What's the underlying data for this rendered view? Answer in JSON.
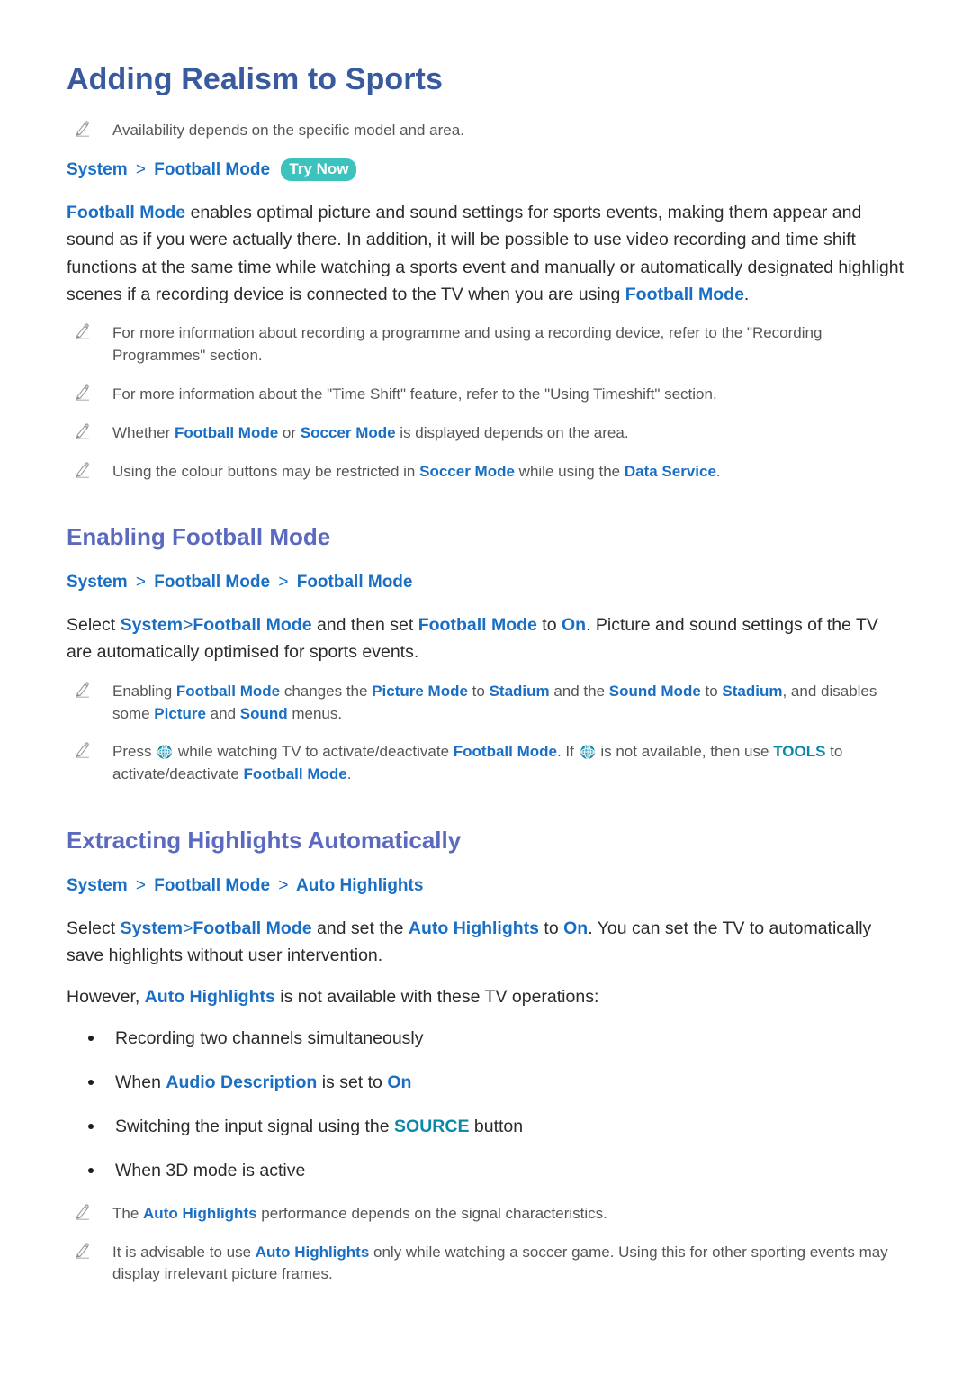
{
  "colors": {
    "title": "#3a5a9e",
    "section_heading": "#5b6abf",
    "link_blue": "#1a6fc4",
    "teal_accent": "#0d87a8",
    "badge_teal": "#3cc3bd",
    "body_text": "#2b2b2b",
    "note_text": "#55565a"
  },
  "doc": {
    "title": "Adding Realism to Sports"
  },
  "intro": {
    "note_availability": "Availability depends on the specific model and area.",
    "breadcrumb": {
      "item1": "System",
      "separator": ">",
      "item2": "Football Mode",
      "badge": "Try Now"
    },
    "paragraph": {
      "kw_football_mode_1": "Football Mode",
      "text_1": " enables optimal picture and sound settings for sports events, making them appear and sound as if you were actually there. In addition, it will be possible to use video recording and time shift functions at the same time while watching a sports event and manually or automatically designated highlight scenes if a recording device is connected to the TV when you are using ",
      "kw_football_mode_2": "Football Mode",
      "text_2": "."
    },
    "notes": {
      "note1": "For more information about recording a programme and using a recording device, refer to the \"Recording Programmes\" section.",
      "note2": "For more information about the \"Time Shift\" feature, refer to the \"Using Timeshift\" section.",
      "note3": {
        "t1": "Whether ",
        "kw1": "Football Mode",
        "t2": " or ",
        "kw2": "Soccer Mode",
        "t3": " is displayed depends on the area."
      },
      "note4": {
        "t1": "Using the colour buttons may be restricted in ",
        "kw1": "Soccer Mode",
        "t2": " while using the ",
        "kw2": "Data Service",
        "t3": "."
      }
    }
  },
  "section_enabling": {
    "heading": "Enabling Football Mode",
    "breadcrumb": {
      "item1": "System",
      "separator": ">",
      "item2": "Football Mode",
      "item3": "Football Mode"
    },
    "paragraph": {
      "t1": "Select ",
      "kw1": "System",
      "sep": ">",
      "kw2": "Football Mode",
      "t2": " and then set ",
      "kw3": "Football Mode",
      "t3": " to ",
      "kw4": "On",
      "t4": ". Picture and sound settings of the TV are automatically optimised for sports events."
    },
    "notes": {
      "note1": {
        "t1": "Enabling ",
        "kw1": "Football Mode",
        "t2": " changes the ",
        "kw2": "Picture Mode",
        "t3": " to ",
        "kw3": "Stadium",
        "t4": " and the ",
        "kw4": "Sound Mode",
        "t5": " to ",
        "kw5": "Stadium",
        "t6": ", and disables some ",
        "kw6": "Picture",
        "t7": " and ",
        "kw7": "Sound",
        "t8": " menus."
      },
      "note2": {
        "t1": "Press ",
        "icon1": "soccer-ball-icon",
        "t2": " while watching TV to activate/deactivate ",
        "kw1": "Football Mode",
        "t3": ". If ",
        "icon2": "soccer-ball-icon",
        "t4": " is not available, then use ",
        "kw2": "TOOLS",
        "t5": " to activate/deactivate ",
        "kw3": "Football Mode",
        "t6": "."
      }
    }
  },
  "section_highlights": {
    "heading": "Extracting Highlights Automatically",
    "breadcrumb": {
      "item1": "System",
      "separator": ">",
      "item2": "Football Mode",
      "item3": "Auto Highlights"
    },
    "paragraph": {
      "t1": "Select ",
      "kw1": "System",
      "sep": ">",
      "kw2": "Football Mode",
      "t2": " and set the ",
      "kw3": "Auto Highlights",
      "t3": " to ",
      "kw4": "On",
      "t4": ". You can set the TV to automatically save highlights without user intervention."
    },
    "paragraph2": {
      "t1": "However, ",
      "kw1": "Auto Highlights",
      "t2": " is not available with these TV operations:"
    },
    "bullets": [
      {
        "t1": "Recording two channels simultaneously",
        "kw1": "",
        "t2": "",
        "kw2": "",
        "t3": ""
      },
      {
        "t1": "When ",
        "kw1": "Audio Description",
        "t2": " is set to ",
        "kw2": "On",
        "t3": ""
      },
      {
        "t1": "Switching the input signal using the ",
        "kw1": "SOURCE",
        "t2": " button",
        "kw2": "",
        "t3": ""
      },
      {
        "t1": "When 3D mode is active",
        "kw1": "",
        "t2": "",
        "kw2": "",
        "t3": ""
      }
    ],
    "notes": {
      "note1": {
        "t1": "The ",
        "kw1": "Auto Highlights",
        "t2": " performance depends on the signal characteristics."
      },
      "note2": {
        "t1": "It is advisable to use ",
        "kw1": "Auto Highlights",
        "t2": " only while watching a soccer game. Using this for other sporting events may display irrelevant picture frames."
      }
    }
  }
}
